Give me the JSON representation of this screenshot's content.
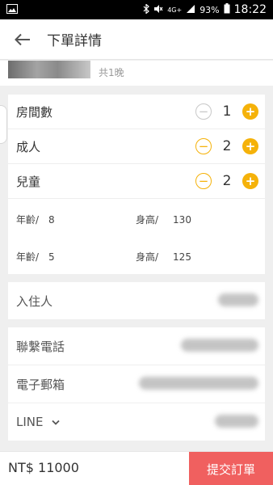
{
  "status_bar": {
    "network": "4G+",
    "battery": "93%",
    "time": "18:22"
  },
  "header": {
    "title": "下單詳情"
  },
  "hotel": {
    "nights": "共1晚"
  },
  "guests": {
    "rooms": {
      "label": "房間數",
      "value": "1"
    },
    "adults": {
      "label": "成人",
      "value": "2"
    },
    "children": {
      "label": "兒童",
      "value": "2"
    },
    "child_details": [
      {
        "age_label": "年齡/",
        "age": "8",
        "height_label": "身高/",
        "height": "130"
      },
      {
        "age_label": "年齡/",
        "age": "5",
        "height_label": "身高/",
        "height": "125"
      }
    ]
  },
  "form": {
    "guest_label": "入住人",
    "phone_label": "聯繫電話",
    "email_label": "電子郵箱",
    "contact_type_label": "LINE"
  },
  "footer": {
    "price": "NT$ 11000",
    "submit_label": "提交訂單"
  },
  "colors": {
    "accent": "#f5b20a",
    "submit": "#f0605f"
  }
}
